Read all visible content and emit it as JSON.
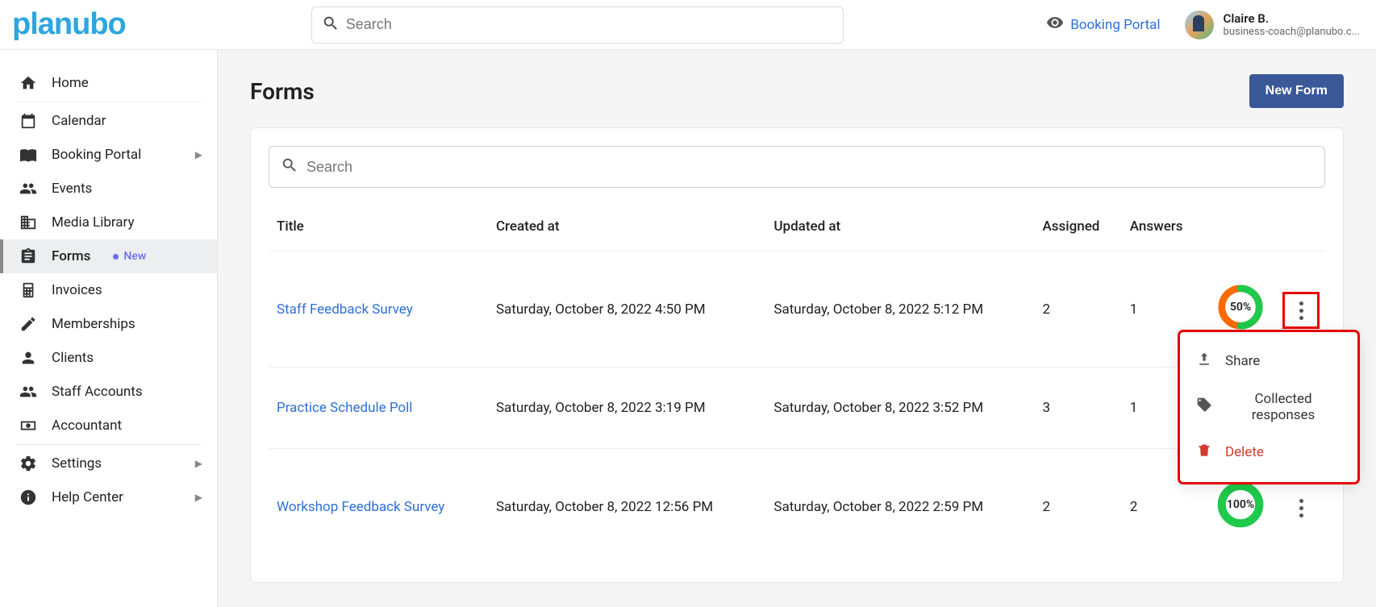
{
  "header": {
    "logo_text": "planubo",
    "search_placeholder": "Search",
    "booking_portal_label": "Booking Portal",
    "user": {
      "name": "Claire B.",
      "email": "business-coach@planubo.c..."
    }
  },
  "sidebar": {
    "items": [
      {
        "label": "Home",
        "icon": "home",
        "chevron": false
      },
      {
        "label": "Calendar",
        "icon": "calendar",
        "chevron": false
      },
      {
        "label": "Booking Portal",
        "icon": "book",
        "chevron": true
      },
      {
        "label": "Events",
        "icon": "users",
        "chevron": false
      },
      {
        "label": "Media Library",
        "icon": "library",
        "chevron": false
      },
      {
        "label": "Forms",
        "icon": "clipboard",
        "chevron": false,
        "active": true,
        "badge": "New"
      },
      {
        "label": "Invoices",
        "icon": "calculator",
        "chevron": false
      },
      {
        "label": "Memberships",
        "icon": "pencil",
        "chevron": false
      },
      {
        "label": "Clients",
        "icon": "person",
        "chevron": false
      },
      {
        "label": "Staff Accounts",
        "icon": "staff",
        "chevron": false
      },
      {
        "label": "Accountant",
        "icon": "money",
        "chevron": false
      },
      {
        "label": "Settings",
        "icon": "gear",
        "chevron": true
      },
      {
        "label": "Help Center",
        "icon": "info",
        "chevron": true
      }
    ]
  },
  "page": {
    "title": "Forms",
    "new_button": "New Form",
    "card_search_placeholder": "Search",
    "columns": {
      "title": "Title",
      "created": "Created at",
      "updated": "Updated at",
      "assigned": "Assigned",
      "answers": "Answers"
    },
    "rows": [
      {
        "title": "Staff Feedback Survey",
        "created": "Saturday, October 8, 2022 4:50 PM",
        "updated": "Saturday, October 8, 2022 5:12 PM",
        "assigned": "2",
        "answers": "1",
        "progress_label": "50%",
        "progress_pct": 50,
        "menu_open": true
      },
      {
        "title": "Practice Schedule Poll",
        "created": "Saturday, October 8, 2022 3:19 PM",
        "updated": "Saturday, October 8, 2022 3:52 PM",
        "assigned": "3",
        "answers": "1",
        "progress_label": "",
        "progress_pct": null,
        "menu_open": false
      },
      {
        "title": "Workshop Feedback Survey",
        "created": "Saturday, October 8, 2022 12:56 PM",
        "updated": "Saturday, October 8, 2022 2:59 PM",
        "assigned": "2",
        "answers": "2",
        "progress_label": "100%",
        "progress_pct": 100,
        "menu_open": false
      }
    ],
    "context_menu": {
      "share": "Share",
      "collected": "Collected responses",
      "delete": "Delete"
    }
  }
}
